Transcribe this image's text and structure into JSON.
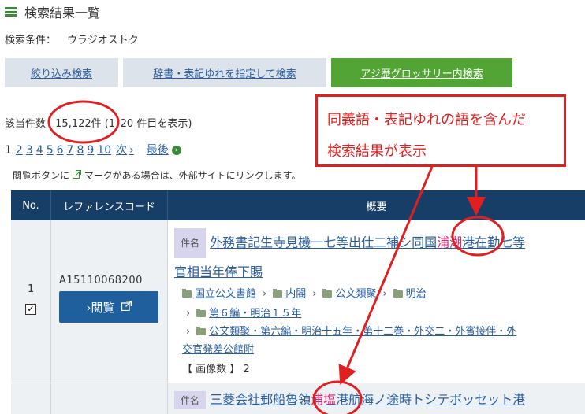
{
  "header": {
    "title": "検索結果一覧"
  },
  "condition": {
    "label": "検索条件：",
    "value": "ウラジオストク"
  },
  "tabs": [
    {
      "label": "絞り込み検索"
    },
    {
      "label": "辞書・表記ゆれを指定して検索"
    },
    {
      "label": "アジ歴グロッサリー内検索"
    }
  ],
  "count": {
    "prefix": "該当件数",
    "value": "15,122件",
    "range": "(1–20 件目を表示)"
  },
  "pager": {
    "current": "1",
    "pages": [
      "2",
      "3",
      "4",
      "5",
      "6",
      "7",
      "8",
      "9",
      "10"
    ],
    "next": "次",
    "next_arrow": "›",
    "last": "最後",
    "last_icon": "›"
  },
  "note": {
    "before": "閲覧ボタンに",
    "icon": "external-link-icon",
    "after": "マークがある場合は、外部サイトにリンクします。"
  },
  "table": {
    "headers": {
      "no": "No.",
      "ref": "レファレンスコード",
      "summary": "概要"
    },
    "row1": {
      "no": "1",
      "ref": "A15110068200",
      "view_label": "›閲覧",
      "tag": "件名",
      "title_pre": "外務書記生寺見機一七等出仕二補シ同国",
      "title_hl": "浦潮",
      "title_post": "港在勤七等",
      "title_line2": "官相当年俸下賜",
      "bc1": [
        "国立公文書館",
        "内閣",
        "公文類聚",
        "明治"
      ],
      "bc2": "第６編・明治１５年",
      "bc3": "公文類聚・第六編・明治十五年・第十二巻・外交二・外賓接伴・外",
      "bc3b": "交官発差公館附",
      "images_label": "【 画像数 】",
      "images_value": "2"
    },
    "row2": {
      "tag": "件名",
      "title_pre": "三菱会社郵船魯領",
      "title_hl": "浦塩",
      "title_post": "港航海ノ途時トシテボッセット港"
    }
  },
  "callout": {
    "line1": "同義語・表記ゆれの語を含んだ",
    "line2": "検索結果が表示"
  },
  "colors": {
    "accent_green": "#52a535",
    "navy": "#173e66",
    "annotation_red": "#e02020",
    "highlight": "#d6286b"
  }
}
